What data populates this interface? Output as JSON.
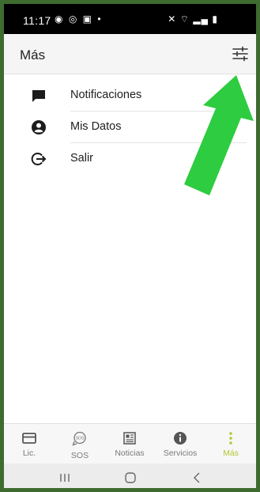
{
  "status_bar": {
    "time": "11:17",
    "left_icons": [
      "whatsapp-icon",
      "instagram-icon",
      "gallery-icon",
      "dot-icon"
    ],
    "right_icons": [
      "mute-icon",
      "wifi-icon",
      "signal-icon",
      "battery-icon"
    ]
  },
  "app_bar": {
    "title": "Más"
  },
  "menu": {
    "items": [
      {
        "label": "Notificaciones",
        "icon": "chat-icon"
      },
      {
        "label": "Mis Datos",
        "icon": "account-circle-icon"
      },
      {
        "label": "Salir",
        "icon": "logout-icon"
      }
    ]
  },
  "bottom_nav": {
    "items": [
      {
        "label": "Lic.",
        "icon": "card-icon",
        "active": false
      },
      {
        "label": "SOS",
        "icon": "sos-icon",
        "active": false
      },
      {
        "label": "Noticias",
        "icon": "newspaper-icon",
        "active": false
      },
      {
        "label": "Servicios",
        "icon": "info-icon",
        "active": false
      },
      {
        "label": "Más",
        "icon": "more-vert-icon",
        "active": true
      }
    ]
  },
  "colors": {
    "frame": "#3e6b2f",
    "arrow": "#2ecc40",
    "active_nav": "#b7c733",
    "icon_dark": "#1c1c1c"
  }
}
